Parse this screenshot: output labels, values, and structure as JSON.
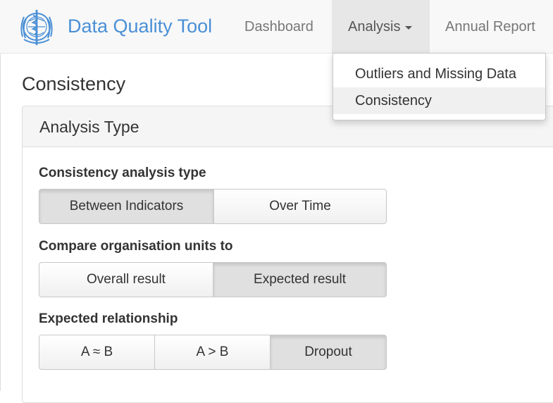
{
  "app": {
    "brand": "Data Quality Tool"
  },
  "nav": {
    "dashboard": "Dashboard",
    "analysis": "Analysis",
    "annual_report": "Annual Report"
  },
  "dropdown": {
    "items": [
      "Outliers and Missing Data",
      "Consistency"
    ],
    "highlighted": "Consistency"
  },
  "page": {
    "title": "Consistency"
  },
  "panel": {
    "title": "Analysis Type"
  },
  "sections": {
    "analysis_type": {
      "label": "Consistency analysis type",
      "options": [
        "Between Indicators",
        "Over Time"
      ],
      "selected": "Between Indicators"
    },
    "compare_to": {
      "label": "Compare organisation units to",
      "options": [
        "Overall result",
        "Expected result"
      ],
      "selected": "Expected result"
    },
    "relationship": {
      "label": "Expected relationship",
      "options": [
        "A ≈ B",
        "A > B",
        "Dropout"
      ],
      "selected": "Dropout"
    }
  },
  "colors": {
    "brand": "#4a8fd6",
    "nav_active_bg": "#e7e7e7"
  }
}
